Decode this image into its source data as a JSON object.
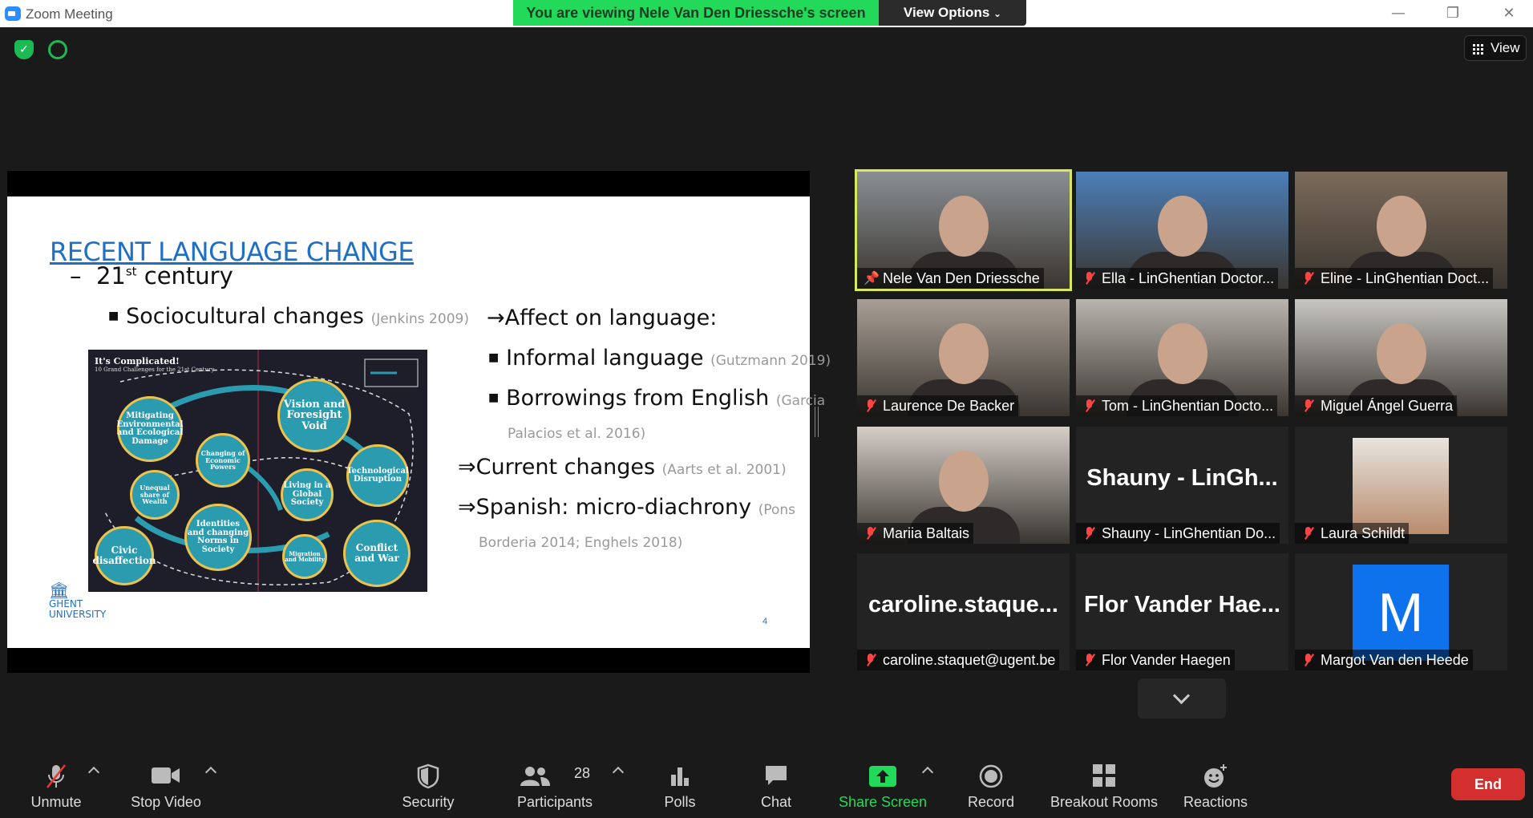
{
  "window": {
    "title": "Zoom Meeting"
  },
  "banner": {
    "viewing": "You are viewing Nele Van Den Driessche's screen",
    "view_options": "View Options"
  },
  "top_right": {
    "view_label": "View"
  },
  "slide": {
    "title": "RECENT LANGUAGE CHANGE",
    "century_num": "21",
    "century_sup": "st",
    "century_rest": " century",
    "bullet1": "Sociocultural changes",
    "bullet1_cite": "(Jenkins 2009)",
    "affect": "Affect on language:",
    "informal": "Informal language",
    "informal_cite": "(Gutzmann 2019)",
    "borrow": "Borrowings from English",
    "borrow_cite1": "(Garcia",
    "borrow_cite2": "Palacios et al. 2016)",
    "current": "Current changes",
    "current_cite": "(Aarts et al. 2001)",
    "spanish": "Spanish: micro-diachrony",
    "spanish_cite1": "(Pons",
    "spanish_cite2": "Borderia 2014; Enghels 2018)",
    "logo_line1": "GHENT",
    "logo_line2": "UNIVERSITY",
    "page_number": "4",
    "figure": {
      "title": "It's Complicated!",
      "subtitle": "10 Grand Challenges for the 21st Century",
      "bubbles": [
        "Mitigating Environmental and Ecological Damage",
        "Changing of Economic Powers",
        "Vision and Foresight Void",
        "Technological Disruption",
        "Unequal share of Wealth",
        "Living in a Global Society",
        "Identities and changing Norms in Society",
        "Civic disaffection",
        "Migration and Mobility",
        "Conflict and War"
      ]
    }
  },
  "participants": [
    {
      "name": "Nele Van Den Driessche",
      "muted": false,
      "pinned": true,
      "bg": "#8a8f93"
    },
    {
      "name": "Ella - LinGhentian Doctor...",
      "muted": true,
      "bg": "#4c7fb8"
    },
    {
      "name": "Eline - LinGhentian Doct...",
      "muted": true,
      "bg": "#7b6a5a"
    },
    {
      "name": "Laurence De Backer",
      "muted": true,
      "bg": "#a89e95"
    },
    {
      "name": "Tom - LinGhentian Docto...",
      "muted": true,
      "bg": "#b9b4ad"
    },
    {
      "name": "Miguel Ángel Guerra",
      "muted": true,
      "bg": "#c8c6c2"
    },
    {
      "name": "Mariia Baltais",
      "muted": true,
      "bg": "#d6cfc8"
    },
    {
      "name": "Shauny - LinGhentian Do...",
      "muted": true,
      "big": "Shauny - LinGh..."
    },
    {
      "name": "Laura Schildt",
      "muted": true,
      "photo": true
    },
    {
      "name": "caroline.staquet@ugent.be",
      "muted": true,
      "big": "caroline.staque..."
    },
    {
      "name": "Flor Vander Haegen",
      "muted": true,
      "big": "Flor Vander Hae..."
    },
    {
      "name": "Margot Van den Heede",
      "muted": true,
      "avatar": "M"
    }
  ],
  "toolbar": {
    "unmute": "Unmute",
    "stop_video": "Stop Video",
    "security": "Security",
    "participants": "Participants",
    "participants_count": "28",
    "polls": "Polls",
    "chat": "Chat",
    "share_screen": "Share Screen",
    "record": "Record",
    "breakout": "Breakout Rooms",
    "reactions": "Reactions",
    "end": "End"
  },
  "colors": {
    "share_green": "#23d959",
    "end_red": "#d32f2f",
    "slide_blue": "#1f6fc5",
    "active_speaker": "#d9e75d",
    "avatar_blue": "#0e72ed"
  }
}
